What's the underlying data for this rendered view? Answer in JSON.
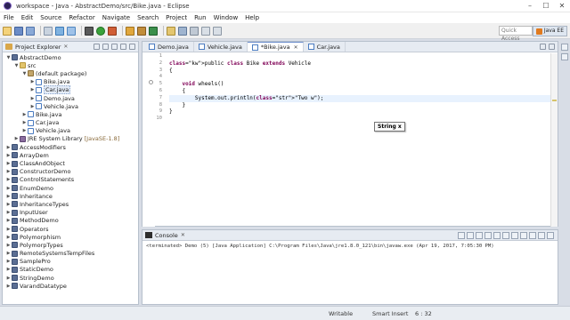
{
  "window": {
    "title": "workspace - Java - AbstractDemo/src/Bike.java - Eclipse",
    "controls": [
      "–",
      "☐",
      "✕"
    ]
  },
  "menu": [
    "File",
    "Edit",
    "Source",
    "Refactor",
    "Navigate",
    "Search",
    "Project",
    "Run",
    "Window",
    "Help"
  ],
  "toolbar": {
    "quick_access": "Quick Access",
    "perspective": "Java EE"
  },
  "project_explorer": {
    "tab_label": "Project Explorer",
    "tree": [
      {
        "label": "AbstractDemo",
        "icon": "project-icon",
        "level": 0,
        "expanded": true
      },
      {
        "label": "src",
        "icon": "folder-icon",
        "level": 1,
        "expanded": true
      },
      {
        "label": "(default package)",
        "icon": "package-icon",
        "level": 2,
        "expanded": true
      },
      {
        "label": "Bike.java",
        "icon": "java-file-icon",
        "level": 3
      },
      {
        "label": "Car.java",
        "icon": "java-file-icon",
        "level": 3,
        "selected": true
      },
      {
        "label": "Demo.java",
        "icon": "java-file-icon",
        "level": 3
      },
      {
        "label": "Vehicle.java",
        "icon": "java-file-icon",
        "level": 3
      },
      {
        "label": "Bike.java",
        "icon": "java-file-icon",
        "level": 2
      },
      {
        "label": "Car.java",
        "icon": "java-file-icon",
        "level": 2
      },
      {
        "label": "Vehicle.java",
        "icon": "java-file-icon",
        "level": 2
      },
      {
        "label": "JRE System Library",
        "suffix": "[JavaSE-1.8]",
        "icon": "library-icon",
        "level": 1
      },
      {
        "label": "AccessModifiers",
        "icon": "project-icon",
        "level": 0
      },
      {
        "label": "ArrayDem",
        "icon": "project-icon",
        "level": 0
      },
      {
        "label": "ClassAndObject",
        "icon": "project-icon",
        "level": 0
      },
      {
        "label": "ConstructorDemo",
        "icon": "project-icon",
        "level": 0
      },
      {
        "label": "ControlStatements",
        "icon": "project-icon",
        "level": 0
      },
      {
        "label": "EnumDemo",
        "icon": "project-icon",
        "level": 0
      },
      {
        "label": "Inheritance",
        "icon": "project-icon",
        "level": 0
      },
      {
        "label": "InheritanceTypes",
        "icon": "project-icon",
        "level": 0
      },
      {
        "label": "InputUser",
        "icon": "project-icon",
        "level": 0
      },
      {
        "label": "MethodDemo",
        "icon": "project-icon",
        "level": 0
      },
      {
        "label": "Operators",
        "icon": "project-icon",
        "level": 0
      },
      {
        "label": "Polymorphism",
        "icon": "project-icon",
        "level": 0
      },
      {
        "label": "PolymorpTypes",
        "icon": "project-icon",
        "level": 0
      },
      {
        "label": "RemoteSystemsTempFiles",
        "icon": "project-icon",
        "level": 0
      },
      {
        "label": "SamplePro",
        "icon": "project-icon",
        "level": 0
      },
      {
        "label": "StaticDemo",
        "icon": "project-icon",
        "level": 0
      },
      {
        "label": "StringDemo",
        "icon": "project-icon",
        "level": 0
      },
      {
        "label": "VarandDatatype",
        "icon": "project-icon",
        "level": 0
      }
    ]
  },
  "editor": {
    "tabs": [
      {
        "label": "Demo.java",
        "active": false
      },
      {
        "label": "Vehicle.java",
        "active": false
      },
      {
        "label": "*Bike.java",
        "active": true
      },
      {
        "label": "Car.java",
        "active": false
      }
    ],
    "lines": [
      {
        "num": "1",
        "text": ""
      },
      {
        "num": "2",
        "text": "public class Bike extends Vehicle"
      },
      {
        "num": "3",
        "text": "{"
      },
      {
        "num": "4",
        "text": ""
      },
      {
        "num": "5",
        "text": "    void wheels()"
      },
      {
        "num": "6",
        "text": "    {"
      },
      {
        "num": "7",
        "text": "        System.out.println(\"Two w\");"
      },
      {
        "num": "8",
        "text": "    }"
      },
      {
        "num": "9",
        "text": "}"
      },
      {
        "num": "10",
        "text": ""
      }
    ],
    "tooltip": "String x"
  },
  "console": {
    "tab_label": "Console",
    "text": "<terminated> Demo (5) [Java Application] C:\\Program Files\\Java\\jre1.8.0_121\\bin\\javaw.exe (Apr 19, 2017, 7:05:30 PM)"
  },
  "status": {
    "writable": "Writable",
    "insert_mode": "Smart Insert",
    "position": "6 : 32"
  },
  "colors": {
    "keyword": "#7f0055",
    "string": "#2a00ff",
    "selection": "#e3ebf7"
  }
}
